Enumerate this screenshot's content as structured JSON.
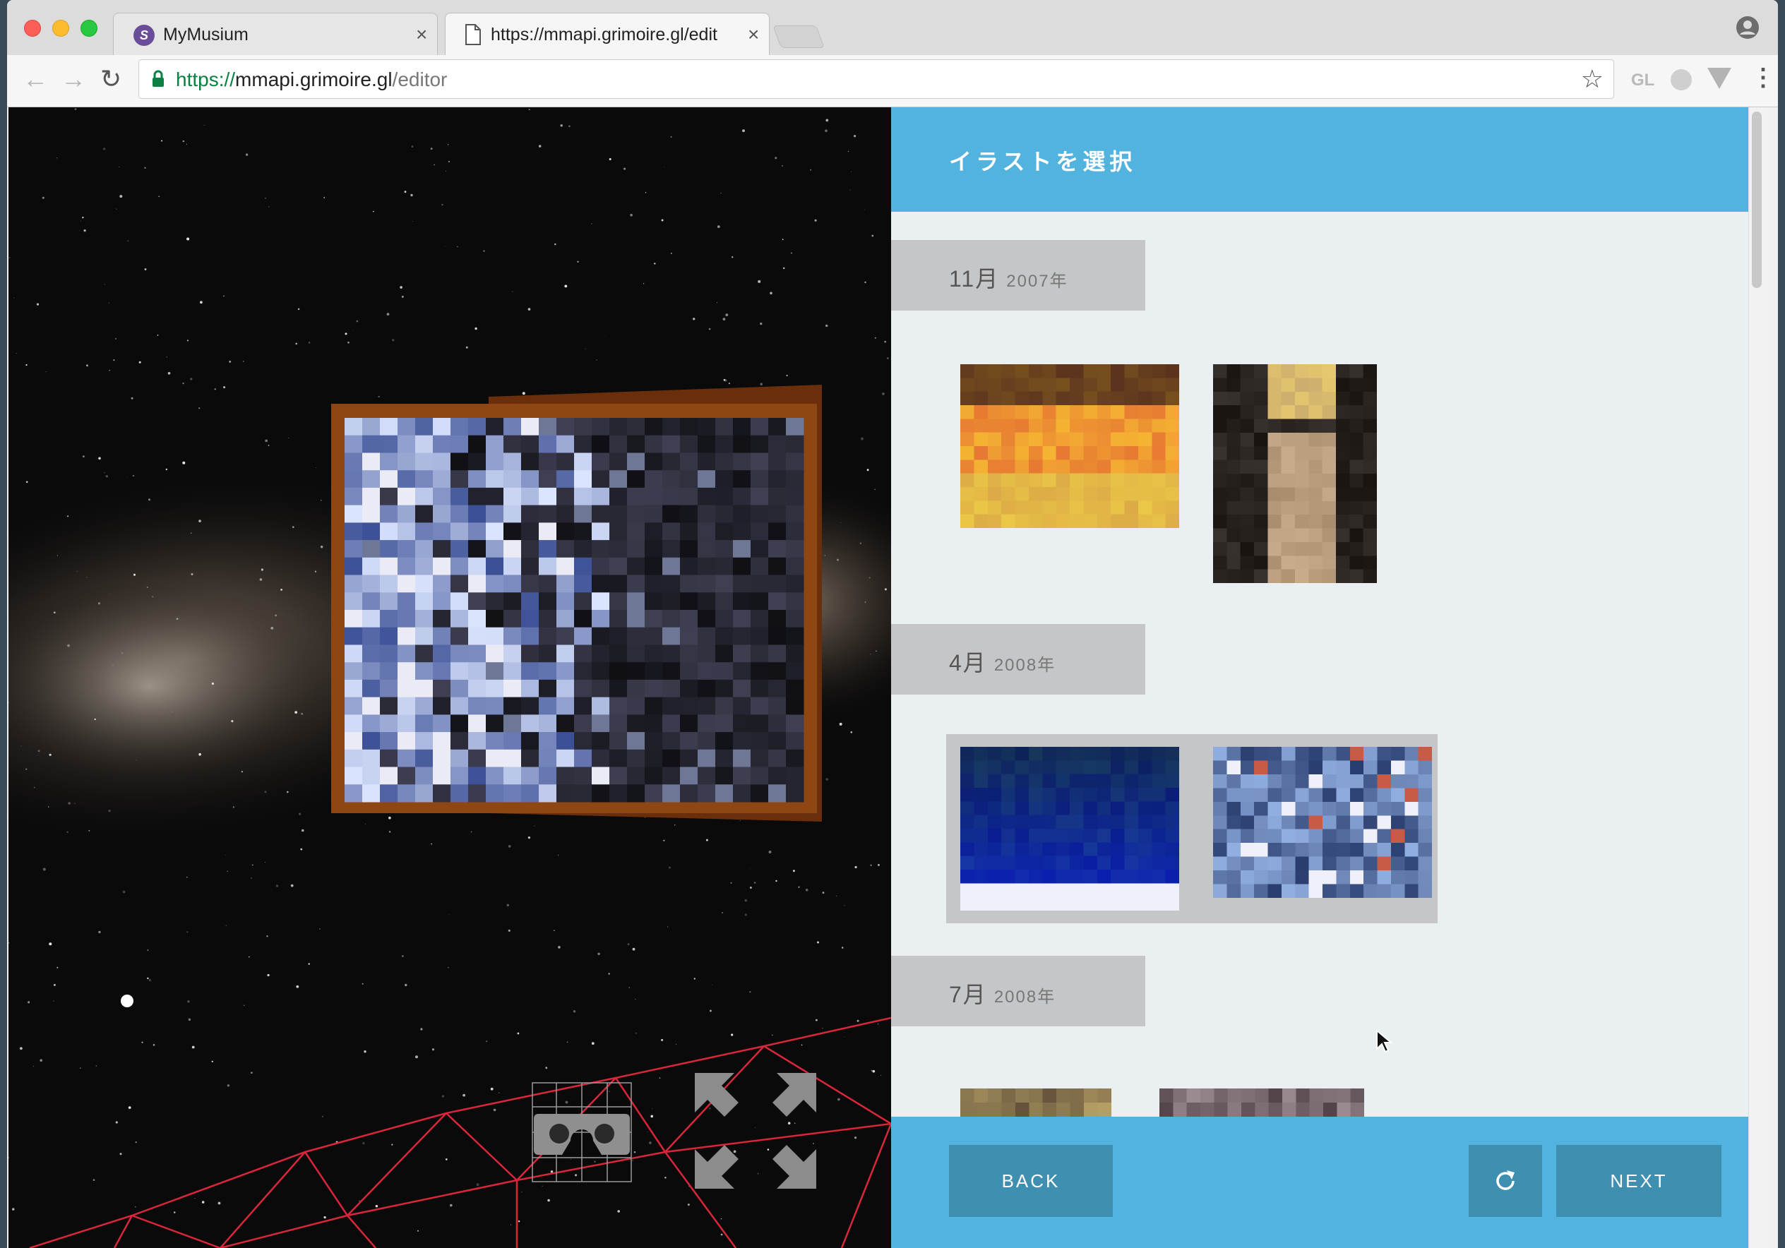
{
  "browser": {
    "tabs": [
      {
        "title": "MyMusium",
        "favicon": "S"
      },
      {
        "title": "https://mmapi.grimoire.gl/edit"
      }
    ],
    "url": {
      "scheme": "https://",
      "host": "mmapi.grimoire.gl",
      "path": "/editor"
    },
    "ext_label": "GL"
  },
  "panel": {
    "title": "イラストを選択",
    "groups": [
      {
        "month": "11月",
        "year": "2007年"
      },
      {
        "month": "4月",
        "year": "2008年"
      },
      {
        "month": "7月",
        "year": "2008年"
      }
    ]
  },
  "footer": {
    "back_label": "BACK",
    "next_label": "NEXT",
    "refresh_icon": "refresh-icon"
  },
  "colors": {
    "accent": "#52b3df",
    "button": "#3f8fb0",
    "frame": "#8a3f10",
    "wireframe": "#e0283a"
  }
}
